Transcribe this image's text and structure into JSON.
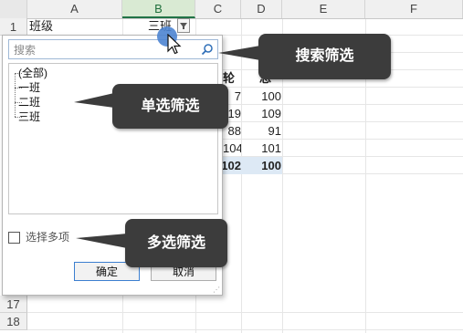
{
  "columns": [
    "A",
    "B",
    "C",
    "D",
    "E",
    "F"
  ],
  "rows_visible_top": [
    "1"
  ],
  "rows_visible_bottom": [
    "17",
    "18"
  ],
  "header_row": {
    "a1": "班级",
    "b1": "三班"
  },
  "partial_cells": {
    "c_header": "轮",
    "d_header": "总",
    "c_values": [
      "7",
      "19",
      "88",
      "104"
    ],
    "d_values": [
      "100",
      "109",
      "91",
      "101"
    ],
    "c_total": "102",
    "d_total": "100"
  },
  "filter_panel": {
    "search_placeholder": "搜索",
    "tree_items": [
      "(全部)",
      "一班",
      "二班",
      "三班"
    ],
    "multi_select_label": "选择多项",
    "ok_label": "确定",
    "cancel_label": "取消"
  },
  "callouts": {
    "search": "搜索筛选",
    "single": "单选筛选",
    "multi": "多选筛选"
  },
  "icons": {
    "search": "magnifier-icon",
    "filter": "filter-funnel-icon",
    "resize": "resize-grip-icon"
  },
  "colors": {
    "selected_column": "#d9ead3",
    "selected_column_text": "#1f6f3c",
    "callout_bg": "#3c3c3c",
    "total_row_bg": "#dde9f5",
    "ok_border": "#3c7fd0"
  }
}
